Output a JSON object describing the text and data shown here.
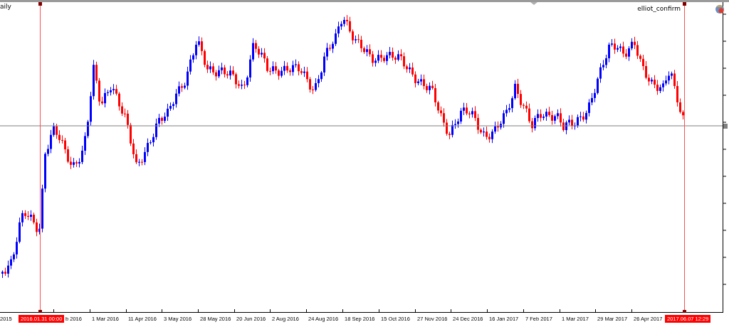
{
  "chart": {
    "title": "aily",
    "indicator": "elliot_confirm",
    "time_axis": [
      "2015",
      "b 2016",
      "1 Mar 2016",
      "11 Apr 2016",
      "3 May 2016",
      "28 May 2016",
      "20 Jun 2016",
      "2 Aug 2016",
      "24 Aug 2016",
      "18 Sep 2016",
      "15 Oct 2016",
      "27 Nov 2016",
      "24 Dec 2016",
      "16 Jan 2017",
      "7 Feb 2017",
      "1 Mar 2017",
      "29 Mar 2017",
      "26 Apr 2017"
    ],
    "markers": [
      {
        "label": "2016.01.31 00:00"
      },
      {
        "label": "2017.06.07 12:29"
      }
    ]
  }
}
